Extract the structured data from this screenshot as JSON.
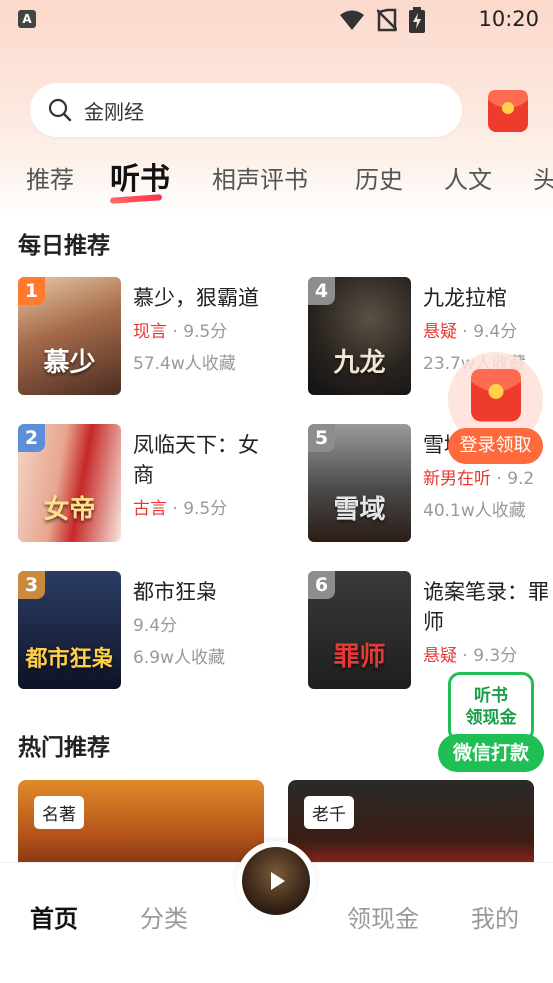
{
  "status_bar": {
    "time": "10:20",
    "app_icon_letter": "A",
    "icons": [
      "wifi-icon",
      "no-sim-icon",
      "battery-charging-icon"
    ]
  },
  "search": {
    "text": "金刚经",
    "icon": "search-icon"
  },
  "tabs": [
    {
      "label": "推荐",
      "active": false
    },
    {
      "label": "听书",
      "active": true
    },
    {
      "label": "相声评书",
      "active": false
    },
    {
      "label": "历史",
      "active": false
    },
    {
      "label": "人文",
      "active": false
    },
    {
      "label": "头",
      "active": false
    }
  ],
  "daily": {
    "title": "每日推荐",
    "books": [
      {
        "rank": "1",
        "title": "慕少，狠霸道",
        "genre": "现言",
        "score": " · 9.5分",
        "fav": "57.4w人收藏",
        "cover_text": "慕少",
        "rank_color": "#ff7a2f"
      },
      {
        "rank": "2",
        "title": "凤临天下：女商",
        "genre": "古言",
        "score": " · 9.5分",
        "fav": "",
        "cover_text": "女帝",
        "rank_color": "#5b8fd8"
      },
      {
        "rank": "3",
        "title": "都市狂枭",
        "genre": "",
        "score": "9.4分",
        "fav": "6.9w人收藏",
        "cover_text": "都市狂枭",
        "rank_color": "#c98a3d"
      },
      {
        "rank": "4",
        "title": "九龙拉棺",
        "genre": "悬疑",
        "score": " · 9.4分",
        "fav": "23.7w人收藏",
        "cover_text": "九龙",
        "rank_color": "#8d8d8d"
      },
      {
        "rank": "5",
        "title": "雪域兵王",
        "genre": "新男在听",
        "score": " · 9.2",
        "fav": "40.1w人收藏",
        "cover_text": "雪域",
        "rank_color": "#8d8d8d"
      },
      {
        "rank": "6",
        "title": "诡案笔录：罪师",
        "genre": "悬疑",
        "score": " · 9.3分",
        "fav": "",
        "cover_text": "罪师",
        "rank_color": "#8d8d8d"
      }
    ]
  },
  "hot": {
    "title": "热门推荐",
    "cards": [
      {
        "tag": "名著"
      },
      {
        "tag": "老千"
      }
    ]
  },
  "floating": {
    "login_claim": "登录领取",
    "listen_cash_line1": "听书",
    "listen_cash_line2": "领现金",
    "wechat_pay": "微信打款"
  },
  "bottom_nav": [
    {
      "label": "首页",
      "active": true
    },
    {
      "label": "分类",
      "active": false
    },
    {
      "label": "领现金",
      "active": false
    },
    {
      "label": "我的",
      "active": false
    }
  ]
}
